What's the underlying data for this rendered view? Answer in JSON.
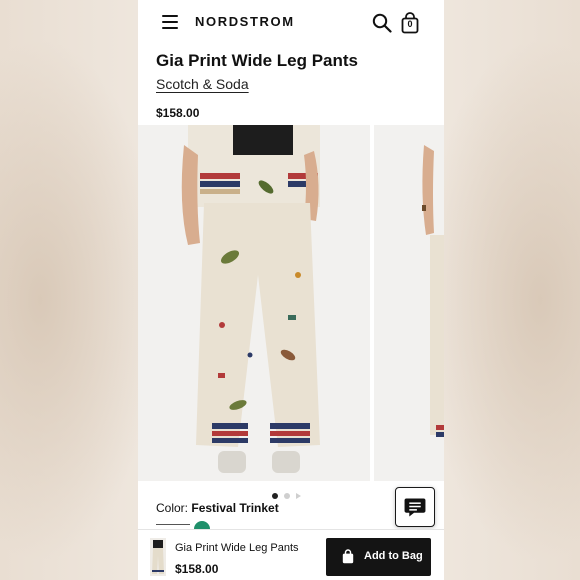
{
  "header": {
    "brand": "NORDSTROM",
    "bag_count": "0"
  },
  "product": {
    "title": "Gia Print Wide Leg Pants",
    "brand": "Scotch & Soda",
    "price": "$158.00"
  },
  "carousel": {
    "total_slides": 3,
    "active_index": 0
  },
  "color": {
    "label": "Color:",
    "value": "Festival Trinket",
    "swatch_color": "#1f8f6a"
  },
  "footer": {
    "name": "Gia Print Wide Leg Pants",
    "price": "$158.00",
    "add_label": "Add to Bag"
  },
  "colors": {
    "primary": "#141414",
    "background": "#ffffff",
    "muted": "#cfcfcf"
  }
}
